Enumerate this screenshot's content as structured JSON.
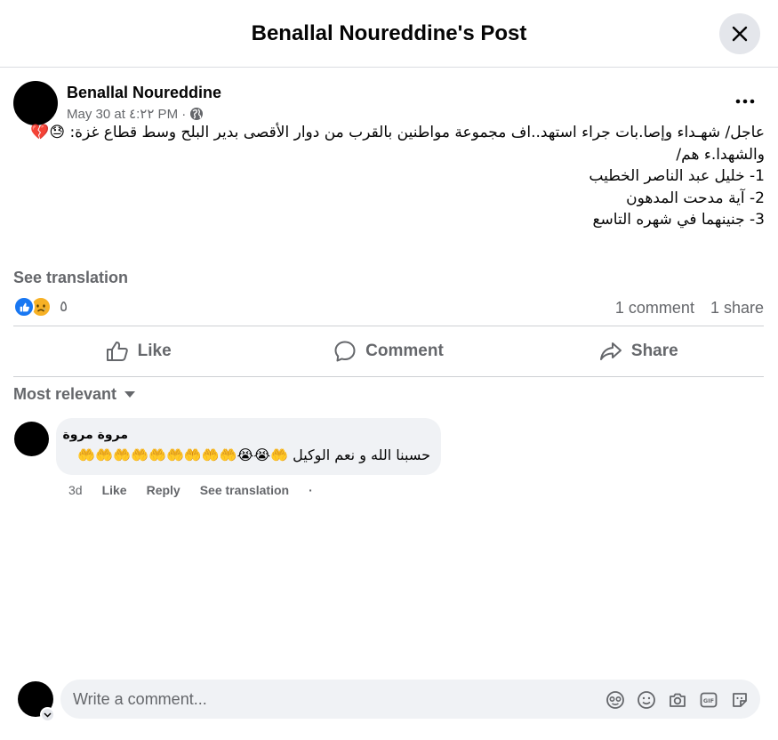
{
  "dialog": {
    "title": "Benallal Noureddine's Post"
  },
  "post": {
    "author": "Benallal Noureddine",
    "date": "May 30 at ٤:٢٢ PM ·",
    "text_line1": "عاجل/ شهـداء وإصا.بات جراء استهد..اف مجموعة مواطنين بالقرب من دوار الأقصى بدير البلح وسط قطاع غزة: 😓💔",
    "text_line2": "والشهدا.ء هم/",
    "text_line3": "1- خليل عبد الناصر الخطيب",
    "text_line4": "2- آية مدحت المدهون",
    "text_line5": "3- جنينهما في شهره التاسع",
    "see_translation": "See translation",
    "reaction_count": "٥",
    "comments_count": "1 comment",
    "shares_count": "1 share"
  },
  "actions": {
    "like": "Like",
    "comment": "Comment",
    "share": "Share"
  },
  "comments_filter": "Most relevant",
  "comment": {
    "author": "مروة مروة",
    "text": "حسبنا الله و نعم الوكيل 🤲😭😭🤲🤲🤲🤲🤲🤲🤲🤲🤲",
    "time": "3d",
    "like": "Like",
    "reply": "Reply",
    "see_translation": "See translation",
    "dot": "·"
  },
  "composer": {
    "placeholder": "Write a comment..."
  },
  "icons": {
    "close": "close-icon",
    "more": "more-icon",
    "privacy": "globe-icon",
    "like": "thumbs-up-icon",
    "comment": "comment-icon",
    "share": "share-icon",
    "filter_caret": "caret-down-icon",
    "avatar_sticker": "avatar-sticker-icon",
    "emoji": "emoji-icon",
    "camera": "camera-icon",
    "gif": "gif-icon",
    "sticker": "sticker-icon"
  },
  "colors": {
    "accent_blue": "#1877f2",
    "secondary_text": "#65676b",
    "bubble_bg": "#f0f2f5",
    "sad_reaction": "#f7b125"
  }
}
